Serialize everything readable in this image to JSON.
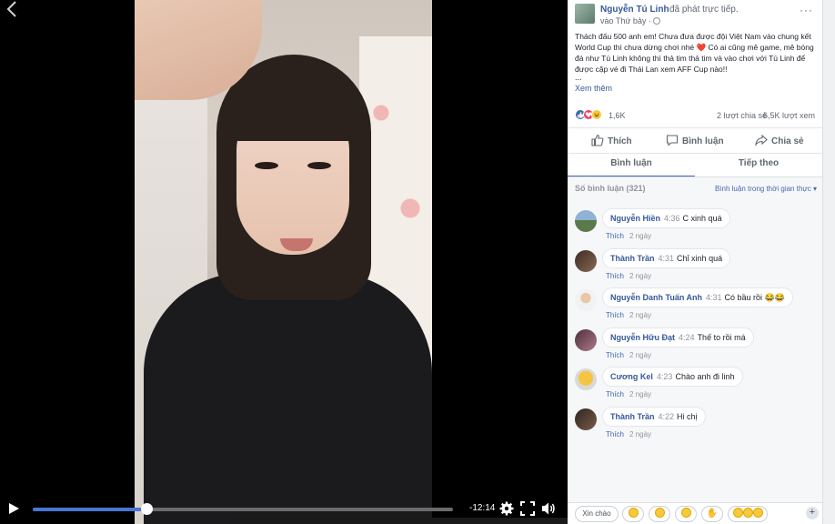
{
  "video": {
    "back_icon": "chevron-left-icon",
    "time_remaining": "-12:14",
    "progress": 0.27,
    "controls": [
      "play-icon",
      "settings-icon",
      "fullscreen-icon",
      "volume-icon"
    ]
  },
  "post": {
    "author": "Nguyễn Tú Linh",
    "action": "đã phát trực tiếp.",
    "time": "vào Thứ bảy ·",
    "text": "Thách đấu 500 anh em! Chưa đưa được đội Việt Nam vào chung kết World Cup thì chưa dừng chơi nhé ❤️ Có ai cũng mê game, mê bóng đá như Tú Linh không thì thả tim thả tim và vào chơi với Tú Linh để được cặp vé đi Thái Lan xem AFF Cup nào!!",
    "ellipsis": "...",
    "see_more": "Xem thêm",
    "reaction_count": "1,6K",
    "shares": "2 lượt chia sẻ",
    "views": "6,5K lượt xem",
    "menu": "···"
  },
  "actions": {
    "like": "Thích",
    "comment": "Bình luận",
    "share": "Chia sẻ"
  },
  "tabs": {
    "comments": "Bình luận",
    "next": "Tiếp theo"
  },
  "comments_header": {
    "count": "Số bình luận (321)",
    "sort": "Bình luận trong thời gian thực"
  },
  "comments": [
    {
      "name": "Nguyễn Hiền",
      "time": "4:36",
      "text": "C xinh quá",
      "like": "Thích",
      "age": "2 ngày"
    },
    {
      "name": "Thành Trần",
      "time": "4:31",
      "text": "Chỉ xinh quá",
      "like": "Thích",
      "age": "2 ngày"
    },
    {
      "name": "Nguyễn Danh Tuấn Anh",
      "time": "4:31",
      "text": "Có bầu rồi 😂😂",
      "like": "Thích",
      "age": "2 ngày"
    },
    {
      "name": "Nguyễn Hữu Đạt",
      "time": "4:24",
      "text": "Thế to rồi má",
      "like": "Thích",
      "age": "2 ngày"
    },
    {
      "name": "Cương Kel",
      "time": "4:23",
      "text": "Chào anh đi linh",
      "like": "Thích",
      "age": "2 ngày"
    },
    {
      "name": "Thành Trần",
      "time": "4:22",
      "text": "Hi chị",
      "like": "Thích",
      "age": "2 ngày"
    }
  ],
  "quick_replies": {
    "greeting": "Xin chào"
  },
  "colors": {
    "accent": "#4267b2",
    "link": "#365899",
    "progress": "#4a76d4"
  }
}
